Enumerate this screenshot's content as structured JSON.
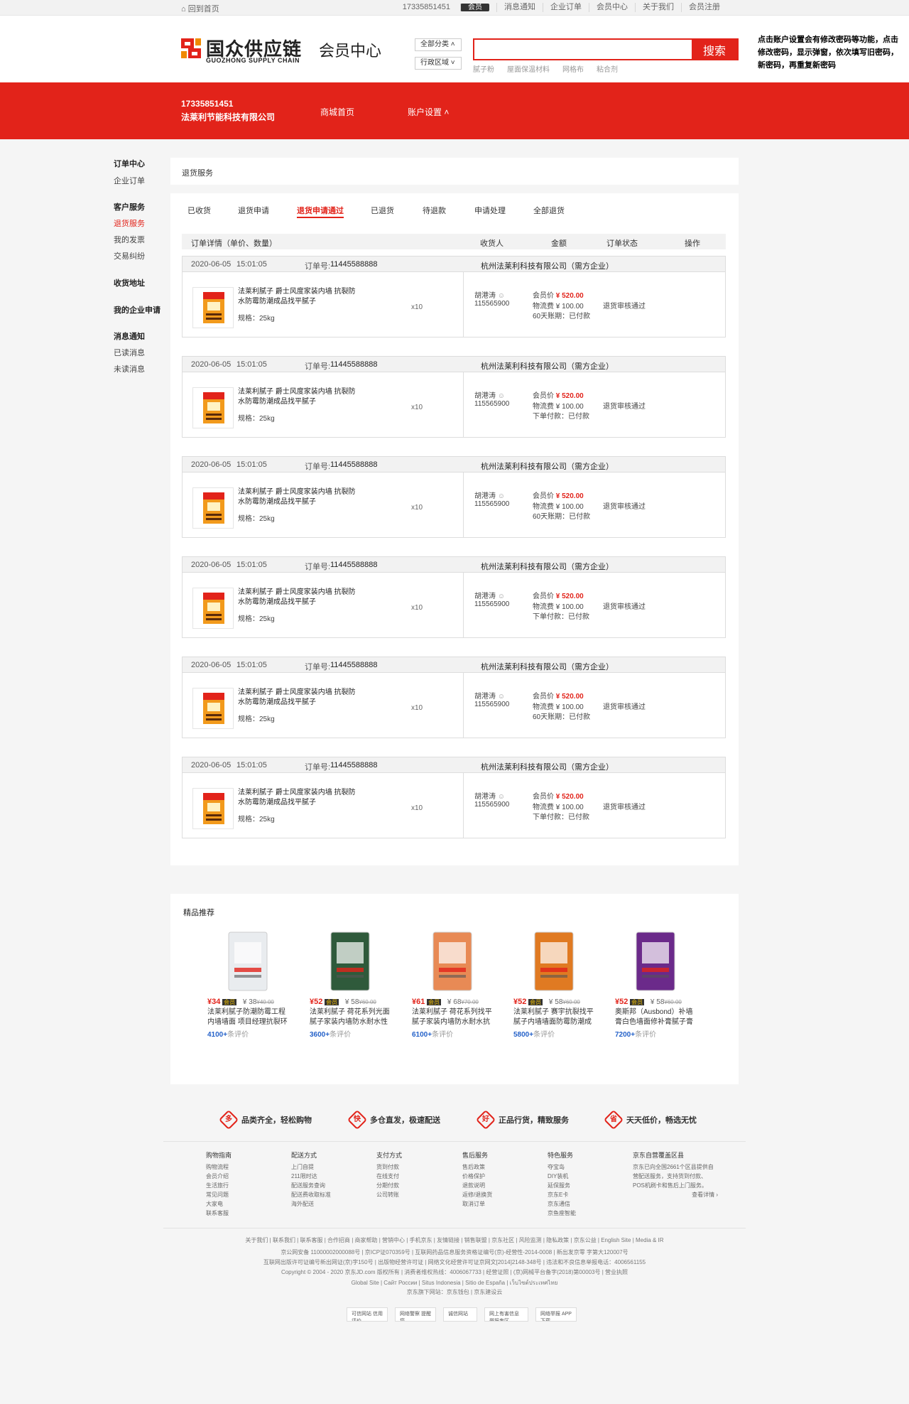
{
  "topbar": {
    "home": "回到首页",
    "phone": "17335851451",
    "member_badge": "会员",
    "links": [
      "消息通知",
      "企业订单",
      "会员中心",
      "关于我们",
      "会员注册"
    ]
  },
  "header": {
    "logo_cn": "国众供应链",
    "logo_en": "GUOZHONG SUPPLY CHAIN",
    "title": "会员中心",
    "category_select": "全部分类",
    "region_select": "行政区域",
    "search_button": "搜索",
    "hot_words": [
      "腻子粉",
      "屋面保温材料",
      "网格布",
      "粘合剂"
    ],
    "note": "点击账户设置会有修改密码等功能，点击修改密码，显示弹窗，依次填写旧密码，新密码，再重复新密码"
  },
  "band": {
    "phone": "17335851451",
    "company": "法莱利节能科技有限公司",
    "nav_mall": "商城首页",
    "nav_account": "账户设置"
  },
  "sidebar": {
    "groups": [
      {
        "title": "订单中心",
        "items": [
          "企业订单"
        ]
      },
      {
        "title": "客户服务",
        "items": [
          "退货服务",
          "我的发票",
          "交易纠纷"
        ]
      },
      {
        "title": "收货地址",
        "items": []
      },
      {
        "title": "我的企业申请",
        "items": []
      },
      {
        "title": "消息通知",
        "items": [
          "已读消息",
          "未读消息"
        ]
      }
    ],
    "active": "退货服务"
  },
  "section_title": "退货服务",
  "tabs": [
    "已收货",
    "退货申请",
    "退货申请通过",
    "已退货",
    "待退款",
    "申请处理",
    "全部退货"
  ],
  "active_tab": "退货申请通过",
  "table_header": {
    "detail": "订单详情（单价、数量）",
    "receiver": "收货人",
    "amount": "金额",
    "status": "订单状态",
    "action": "操作"
  },
  "orders": [
    {
      "date": "2020-06-05",
      "time": "15:01:05",
      "order_no_label": "订单号:",
      "order_no": "11445588888",
      "buyer": "杭州法莱利科技有限公司（需方企业）",
      "product_name": "法莱利腻子  爵士风度家装内墙  抗裂防水防霉防潮成品找平腻子",
      "spec": "规格：25kg",
      "qty": "x10",
      "receiver": "胡港涛",
      "receiver_phone": "115565900",
      "member_price_label": "会员价",
      "member_price": "¥ 520.00",
      "freight": "物流费 ¥ 100.00",
      "pay_term": "60天账期：已付款",
      "status": "退货审核通过"
    },
    {
      "date": "2020-06-05",
      "time": "15:01:05",
      "order_no_label": "订单号:",
      "order_no": "11445588888",
      "buyer": "杭州法莱利科技有限公司（需方企业）",
      "product_name": "法莱利腻子  爵士风度家装内墙  抗裂防水防霉防潮成品找平腻子",
      "spec": "规格：25kg",
      "qty": "x10",
      "receiver": "胡港涛",
      "receiver_phone": "115565900",
      "member_price_label": "会员价",
      "member_price": "¥ 520.00",
      "freight": "物流费 ¥ 100.00",
      "pay_term": "下单付款：已付款",
      "status": "退货审核通过"
    },
    {
      "date": "2020-06-05",
      "time": "15:01:05",
      "order_no_label": "订单号:",
      "order_no": "11445588888",
      "buyer": "杭州法莱利科技有限公司（需方企业）",
      "product_name": "法莱利腻子  爵士风度家装内墙  抗裂防水防霉防潮成品找平腻子",
      "spec": "规格：25kg",
      "qty": "x10",
      "receiver": "胡港涛",
      "receiver_phone": "115565900",
      "member_price_label": "会员价",
      "member_price": "¥ 520.00",
      "freight": "物流费 ¥ 100.00",
      "pay_term": "60天账期：已付款",
      "status": "退货审核通过"
    },
    {
      "date": "2020-06-05",
      "time": "15:01:05",
      "order_no_label": "订单号:",
      "order_no": "11445588888",
      "buyer": "杭州法莱利科技有限公司（需方企业）",
      "product_name": "法莱利腻子  爵士风度家装内墙  抗裂防水防霉防潮成品找平腻子",
      "spec": "规格：25kg",
      "qty": "x10",
      "receiver": "胡港涛",
      "receiver_phone": "115565900",
      "member_price_label": "会员价",
      "member_price": "¥ 520.00",
      "freight": "物流费 ¥ 100.00",
      "pay_term": "下单付款：已付款",
      "status": "退货审核通过"
    },
    {
      "date": "2020-06-05",
      "time": "15:01:05",
      "order_no_label": "订单号:",
      "order_no": "11445588888",
      "buyer": "杭州法莱利科技有限公司（需方企业）",
      "product_name": "法莱利腻子  爵士风度家装内墙  抗裂防水防霉防潮成品找平腻子",
      "spec": "规格：25kg",
      "qty": "x10",
      "receiver": "胡港涛",
      "receiver_phone": "115565900",
      "member_price_label": "会员价",
      "member_price": "¥ 520.00",
      "freight": "物流费 ¥ 100.00",
      "pay_term": "60天账期：已付款",
      "status": "退货审核通过"
    },
    {
      "date": "2020-06-05",
      "time": "15:01:05",
      "order_no_label": "订单号:",
      "order_no": "11445588888",
      "buyer": "杭州法莱利科技有限公司（需方企业）",
      "product_name": "法莱利腻子  爵士风度家装内墙  抗裂防水防霉防潮成品找平腻子",
      "spec": "规格：25kg",
      "qty": "x10",
      "receiver": "胡港涛",
      "receiver_phone": "115565900",
      "member_price_label": "会员价",
      "member_price": "¥ 520.00",
      "freight": "物流费 ¥ 100.00",
      "pay_term": "下单付款：已付款",
      "status": "退货审核通过"
    }
  ],
  "recommend": {
    "title": "精品推荐",
    "items": [
      {
        "price": "¥34",
        "badge": "会员",
        "orig": "¥ 38",
        "orig_strike": "¥40.00",
        "name": "法莱利腻子防潮防霉工程内墙墙面 项目经理抗裂环保找",
        "count": "4100+",
        "count_suffix": "条评价",
        "bag_color": "#e9ecef"
      },
      {
        "price": "¥52",
        "badge": "会员",
        "orig": "¥ 58",
        "orig_strike": "¥60.00",
        "name": "法莱利腻子 荷花系列光面腻子家装内墙防水耐水性好环",
        "count": "3600+",
        "count_suffix": "条评价",
        "bag_color": "#2f5a3b"
      },
      {
        "price": "¥61",
        "badge": "会员",
        "orig": "¥ 68",
        "orig_strike": "¥70.00",
        "name": "法莱利腻子 荷花系列找平腻子家装内墙防水耐水抗裂性",
        "count": "6100+",
        "count_suffix": "条评价",
        "bag_color": "#e88a55"
      },
      {
        "price": "¥52",
        "badge": "会员",
        "orig": "¥ 58",
        "orig_strike": "¥60.00",
        "name": "法莱利腻子 赛宇抗裂找平腻子内墙墙面防霉防潮成品耐",
        "count": "5800+",
        "count_suffix": "条评价",
        "bag_color": "#e07a22"
      },
      {
        "price": "¥52",
        "badge": "会员",
        "orig": "¥ 58",
        "orig_strike": "¥60.00",
        "name": "奥斯邦（Ausbond）补墙膏白色墙面修补膏腻子膏粉刷",
        "count": "7200+",
        "count_suffix": "条评价",
        "bag_color": "#6b2a8a"
      }
    ]
  },
  "services": [
    {
      "icon": "多",
      "text": "品类齐全，轻松购物"
    },
    {
      "icon": "快",
      "text": "多仓直发，极速配送"
    },
    {
      "icon": "好",
      "text": "正品行货，精致服务"
    },
    {
      "icon": "省",
      "text": "天天低价，畅选无忧"
    }
  ],
  "footer_cols": [
    {
      "title": "购物指南",
      "items": [
        "购物流程",
        "会员介绍",
        "生活旅行",
        "常见问题",
        "大家电",
        "联系客服"
      ]
    },
    {
      "title": "配送方式",
      "items": [
        "上门自提",
        "211限时达",
        "配送服务查询",
        "配送费收取标准",
        "海外配送"
      ]
    },
    {
      "title": "支付方式",
      "items": [
        "货到付款",
        "在线支付",
        "分期付款",
        "公司转账"
      ]
    },
    {
      "title": "售后服务",
      "items": [
        "售后政策",
        "价格保护",
        "退款说明",
        "返修/退换货",
        "取消订单"
      ]
    },
    {
      "title": "特色服务",
      "items": [
        "夺宝岛",
        "DIY装机",
        "延保服务",
        "京东E卡",
        "京东通信",
        "京鱼座智能"
      ]
    },
    {
      "title": "京东自营覆盖区县",
      "items": [
        "京东已向全国2661个区县提供自营配送服务，支持货到付款、POS机刷卡和售后上门服务。",
        "查看详情 ›"
      ]
    }
  ],
  "footer_links": "关于我们 | 联系我们 | 联系客服 | 合作招商 | 商家帮助 | 营销中心 | 手机京东 | 友情链接 | 销售联盟 | 京东社区 | 风险监测 | 隐私政策 | 京东公益 | English Site | Media & IR",
  "footer_lines": [
    "京公网安备 11000002000088号  |  京ICP证070359号  |  互联网药品信息服务资格证编号(京)-经营性-2014-0008  |  新出发京零 字第大120007号",
    "互联网出版许可证编号新出网证(京)字150号  |  出版物经营许可证  |  网络文化经营许可证京网文[2014]2148-348号  |  违法和不良信息举报电话：4006561155",
    "Copyright © 2004 - 2020  京东JD.com 版权所有  |  消费者维权热线：4006067733  |  经营证照  |  (京)网械平台备字(2018)第00003号  |  营业执照",
    "Global Site  |  Сайт России  |  Situs Indonesia  |  Sitio de España  |  เว็บไซต์ประเทศไทย",
    "京东旗下网站：京东钱包  |  京东建设云"
  ],
  "badges": [
    "可信网站 信用评价",
    "网络警察 提醒您",
    "诚信网站",
    "网上有害信息 举报专区",
    "网络举报 APP下载"
  ]
}
